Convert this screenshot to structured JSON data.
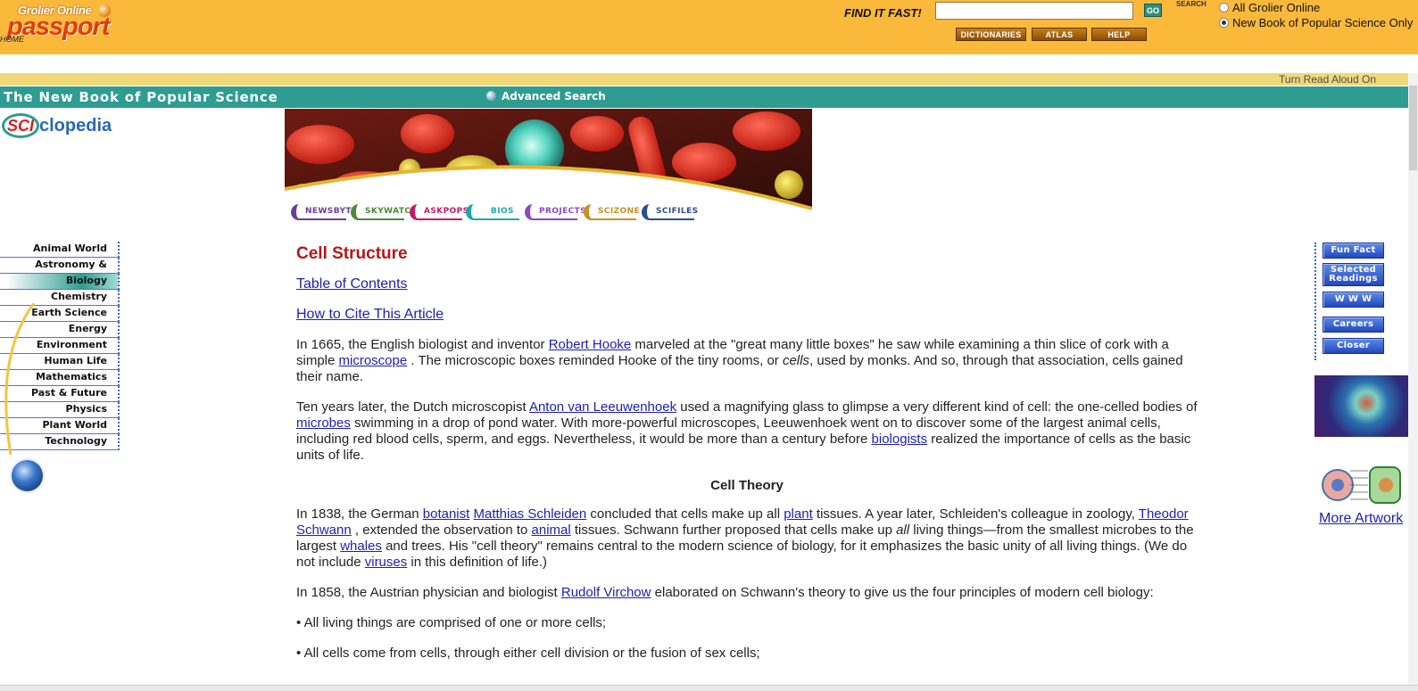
{
  "header": {
    "logo_brand": "Grolier Online",
    "logo_name": "passport",
    "home_label": "HOME",
    "find_label": "FIND IT FAST!",
    "search_value": "",
    "go_label": "GO",
    "search_label": "SEARCH",
    "buttons": [
      "DICTIONARIES",
      "ATLAS",
      "HELP"
    ],
    "scope_options": [
      {
        "label": "All Grolier Online",
        "selected": false
      },
      {
        "label": "New Book of Popular Science Only",
        "selected": true
      }
    ]
  },
  "read_aloud": "Turn Read Aloud On",
  "title_bar": {
    "title": "The New Book of Popular Science",
    "advanced_search": "Advanced Search"
  },
  "sciclopedia": {
    "sci": "SCI",
    "rest": "clopedia"
  },
  "section_tabs": [
    {
      "label": "NEWSBYTES",
      "color": "#6a3d9a"
    },
    {
      "label": "SKYWATCH",
      "color": "#4a8a3a"
    },
    {
      "label": "ASKPOPSCI",
      "color": "#c41a66"
    },
    {
      "label": "BIOS",
      "color": "#20a8a8"
    },
    {
      "label": "PROJECTS",
      "color": "#8a4bc0"
    },
    {
      "label": "SCIZONE",
      "color": "#c89020"
    },
    {
      "label": "SCIFILES",
      "color": "#2d4d8e"
    }
  ],
  "left_nav": [
    {
      "label": "Animal World",
      "active": false
    },
    {
      "label": "Astronomy & Space",
      "active": false
    },
    {
      "label": "Biology",
      "active": true
    },
    {
      "label": "Chemistry",
      "active": false
    },
    {
      "label": "Earth Science",
      "active": false
    },
    {
      "label": "Energy",
      "active": false
    },
    {
      "label": "Environment",
      "active": false
    },
    {
      "label": "Human Life",
      "active": false
    },
    {
      "label": "Mathematics",
      "active": false
    },
    {
      "label": "Past & Future",
      "active": false
    },
    {
      "label": "Physics",
      "active": false
    },
    {
      "label": "Plant World",
      "active": false
    },
    {
      "label": "Technology",
      "active": false
    }
  ],
  "article": {
    "title": "Cell Structure",
    "toc": "Table of Contents",
    "cite": "How to Cite This Article",
    "p1": [
      "In 1665, the English biologist and inventor ",
      "Robert Hooke",
      " marveled at the \"great many little boxes\" he saw while examining a thin slice of cork with a simple ",
      "microscope",
      " . The microscopic boxes reminded Hooke of the tiny rooms, or ",
      "cells",
      ", used by monks. And so, through that association, cells gained their name."
    ],
    "p2": [
      "Ten years later, the Dutch microscopist ",
      "Anton van Leeuwenhoek",
      " used a magnifying glass to glimpse a very different kind of cell: the one-celled bodies of ",
      "microbes",
      " swimming in a drop of pond water. With more-powerful microscopes, Leeuwenhoek went on to discover some of the largest animal cells, including red blood cells, sperm, and eggs. Nevertheless, it would be more than a century before ",
      "biologists",
      " realized the importance of cells as the basic units of life."
    ],
    "section_head": "Cell Theory",
    "p3": [
      "In 1838, the German ",
      "botanist",
      " ",
      "Matthias Schleiden",
      " concluded that cells make up all ",
      "plant",
      " tissues. A year later, Schleiden's colleague in zoology, ",
      "Theodor Schwann",
      " , extended the observation to ",
      "animal",
      " tissues. Schwann further proposed that cells make up ",
      "all",
      " living things—from the smallest microbes to the largest ",
      "whales",
      " and trees. His \"cell theory\" remains central to the modern science of biology, for it emphasizes the basic unity of all living things. (We do not include ",
      "viruses",
      " in this definition of life.)"
    ],
    "p4": [
      "In 1858, the Austrian physician and biologist ",
      "Rudolf Virchow",
      " elaborated on Schwann's theory to give us the four principles of modern cell biology:"
    ],
    "bullet1": "• All living things are comprised of one or more cells;",
    "bullet2": "• All cells come from cells, through either cell division or the fusion of sex cells;"
  },
  "right_rail": {
    "buttons": [
      "Fun Fact",
      "Selected Readings",
      "W W W",
      "Careers",
      "Closer Look"
    ],
    "more_artwork": "More Artwork"
  },
  "colors": {
    "header_bg": "#fbb93c",
    "title_bar": "#2e9c91",
    "read_aloud_bar": "#efd97a",
    "article_title": "#b31818",
    "link": "#1f1fa9"
  }
}
